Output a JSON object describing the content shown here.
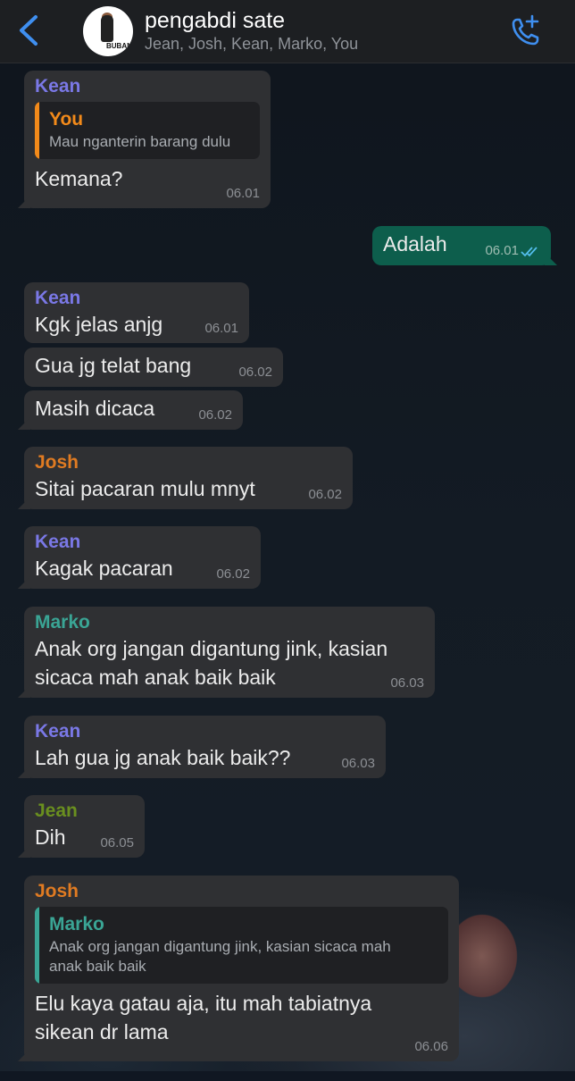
{
  "header": {
    "back_icon": "chevron-left-icon",
    "group_name": "pengabdi sate",
    "members": "Jean, Josh, Kean, Marko, You",
    "avatar_label": "BUBAN",
    "call_icon": "phone-plus-icon"
  },
  "colors": {
    "kean": "#7a78e6",
    "you": "#f28a1a",
    "josh": "#e07b22",
    "marko": "#3aa595",
    "jean": "#6a8f1f",
    "incoming_bubble": "#2f3033",
    "outgoing_bubble": "#0d5e4c",
    "read_ticks": "#53bdeb"
  },
  "messages": [
    {
      "sender": "Kean",
      "quote": {
        "sender": "You",
        "text": "Mau nganterin barang dulu"
      },
      "text": "Kemana?",
      "time": "06.01"
    },
    {
      "sender": "You",
      "text": "Adalah",
      "time": "06.01",
      "status": "read"
    },
    {
      "sender": "Kean",
      "text": "Kgk jelas anjg",
      "time": "06.01"
    },
    {
      "text": "Gua jg telat bang",
      "time": "06.02"
    },
    {
      "text": "Masih dicaca",
      "time": "06.02"
    },
    {
      "sender": "Josh",
      "text": "Sitai pacaran mulu mnyt",
      "time": "06.02"
    },
    {
      "sender": "Kean",
      "text": "Kagak pacaran",
      "time": "06.02"
    },
    {
      "sender": "Marko",
      "text_lines": [
        "Anak org jangan digantung jink, kasian",
        "sicaca mah anak baik baik"
      ],
      "time": "06.03"
    },
    {
      "sender": "Kean",
      "text": "Lah gua jg anak baik baik??",
      "time": "06.03"
    },
    {
      "sender": "Jean",
      "text": "Dih",
      "time": "06.05"
    },
    {
      "sender": "Josh",
      "quote": {
        "sender": "Marko",
        "text_lines": [
          "Anak org jangan digantung jink, kasian sicaca mah",
          "anak baik baik"
        ]
      },
      "text_lines": [
        "Elu kaya gatau aja, itu mah tabiatnya",
        "sikean dr lama"
      ],
      "time": "06.06"
    }
  ]
}
